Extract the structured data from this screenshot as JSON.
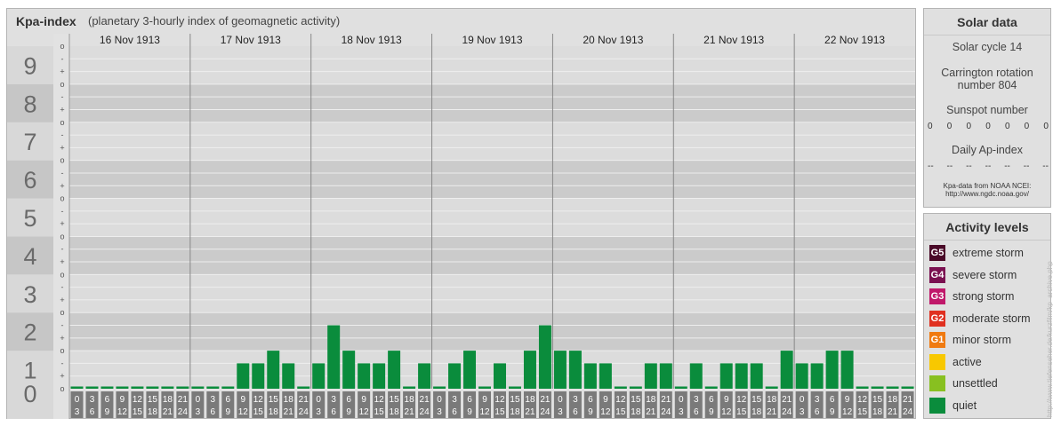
{
  "header": {
    "title": "Kpa-index",
    "subtitle": "(planetary 3-hourly index of geomagnetic activity)"
  },
  "chart_data": {
    "type": "bar",
    "ylim": [
      0,
      9
    ],
    "y_tick_labels": [
      "0",
      "1",
      "2",
      "3",
      "4",
      "5",
      "6",
      "7",
      "8",
      "9"
    ],
    "minor_tick_labels": [
      "o",
      "+",
      "-",
      "o"
    ],
    "days": [
      "16 Nov 1913",
      "17 Nov 1913",
      "18 Nov 1913",
      "19 Nov 1913",
      "20 Nov 1913",
      "21 Nov 1913",
      "22 Nov 1913"
    ],
    "interval_start_labels": [
      "0",
      "3",
      "6",
      "9",
      "12",
      "15",
      "18",
      "21"
    ],
    "interval_end_labels": [
      "3",
      "6",
      "9",
      "12",
      "15",
      "18",
      "21",
      "24"
    ],
    "values": [
      [
        0,
        0,
        0,
        0,
        0,
        0,
        0,
        0
      ],
      [
        0,
        0,
        0,
        0.667,
        0.667,
        1,
        0.667,
        0
      ],
      [
        0.667,
        1.667,
        1,
        0.667,
        0.667,
        1,
        0,
        0.667
      ],
      [
        0,
        0.667,
        1,
        0,
        0.667,
        0,
        1,
        1.667
      ],
      [
        1,
        1,
        0.667,
        0.667,
        0,
        0,
        0.667,
        0.667
      ],
      [
        0,
        0.667,
        0,
        0.667,
        0.667,
        0.667,
        0,
        1
      ],
      [
        0.667,
        0.667,
        1,
        1,
        0,
        0,
        0,
        0
      ]
    ],
    "bar_color": "#0a8c3c"
  },
  "solar": {
    "title": "Solar data",
    "cycle": "Solar cycle 14",
    "carrington_line1": "Carrington rotation",
    "carrington_line2": "number 804",
    "sunspot_title": "Sunspot number",
    "sunspot_values": [
      "0",
      "0",
      "0",
      "0",
      "0",
      "0",
      "0"
    ],
    "ap_title": "Daily Ap-index",
    "ap_values": [
      "--",
      "--",
      "--",
      "--",
      "--",
      "--",
      "--"
    ],
    "source_line1": "Kpa-data from NOAA NCEI:",
    "source_line2": "http://www.ngdc.noaa.gov/"
  },
  "activity": {
    "title": "Activity levels",
    "levels": [
      {
        "code": "G5",
        "label": "extreme storm",
        "color": "#4a0a28"
      },
      {
        "code": "G4",
        "label": "severe storm",
        "color": "#7a1050"
      },
      {
        "code": "G3",
        "label": "strong storm",
        "color": "#c0186a"
      },
      {
        "code": "G2",
        "label": "moderate storm",
        "color": "#e03020"
      },
      {
        "code": "G1",
        "label": "minor storm",
        "color": "#f07a10"
      },
      {
        "code": "",
        "label": "active",
        "color": "#f8c800"
      },
      {
        "code": "",
        "label": "unsettled",
        "color": "#88c020"
      },
      {
        "code": "",
        "label": "quiet",
        "color": "#0a8c3c"
      }
    ]
  },
  "watermark": "http://www.tiefenseher.de/kurzfilm/kp_archive.php"
}
